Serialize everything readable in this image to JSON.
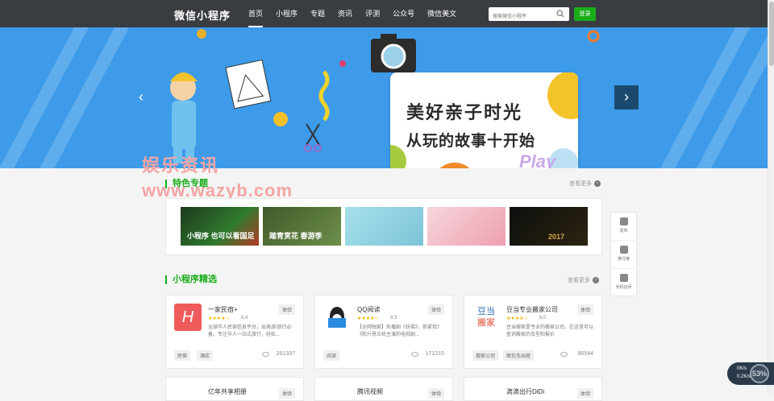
{
  "header": {
    "logo": "微信小程序",
    "nav": [
      "首页",
      "小程序",
      "专题",
      "资讯",
      "评测",
      "公众号",
      "微信美文"
    ],
    "search_placeholder": "搜索微信小程序",
    "login": "登录"
  },
  "banner": {
    "title": "美好亲子时光",
    "subtitle": "从玩的故事十开始",
    "play": "Play"
  },
  "watermark": {
    "line1": "娱乐资讯",
    "line2": "www.wazyb.com"
  },
  "featured": {
    "title": "特色专题",
    "more": "查看更多",
    "topics": [
      {
        "label": "小程序 也可以看国足",
        "color": "#2b5a2a"
      },
      {
        "label": "踏青赏花 春游季",
        "color": "#4d6f3a"
      },
      {
        "label": "",
        "color": "#8fd4e0"
      },
      {
        "label": "",
        "color": "#f3cad1"
      },
      {
        "label": "2017",
        "color": "#1a1a1a"
      }
    ]
  },
  "apps_section": {
    "title": "小程序精选",
    "more": "查看更多",
    "apps": [
      {
        "name": "一家民宿+",
        "tag": "体验",
        "score": "8.4",
        "desc": "全球华人民宿信息平台，出境游/旅行必备。专注华人一站式旅行，轻松...",
        "cats": [
          "民宿",
          "酒店"
        ],
        "views": "261337",
        "icon_color": "#ef5a5a"
      },
      {
        "name": "QQ阅读",
        "tag": "体验",
        "score": "8.3",
        "desc": "【全网独家】热播剧《扶摇》、抓紧我》《陈升恩王机主演的电视剧...",
        "cats": [
          "阅读"
        ],
        "views": "171215",
        "icon_color": "#ffffff"
      },
      {
        "name": "豆当专业搬家公司",
        "tag": "体验",
        "score": "8.0",
        "desc": "豆当搬家是专业的搬家公司，在这里可以查询搬家的车型和报价",
        "cats": [
          "搬家公司",
          "面包车出租"
        ],
        "views": "86544",
        "icon_color": "#ffffff"
      }
    ],
    "row2": [
      {
        "name": "亿年共享相册",
        "tag": "体验"
      },
      {
        "name": "腾讯视频",
        "tag": "体验"
      },
      {
        "name": "滴滴出行DiDi",
        "tag": "体验"
      }
    ]
  },
  "sidebar": [
    "发布",
    "排行榜",
    "手机访问"
  ],
  "speed": {
    "up": "0K/s",
    "down": "0.2K/s",
    "percent": "53%"
  }
}
